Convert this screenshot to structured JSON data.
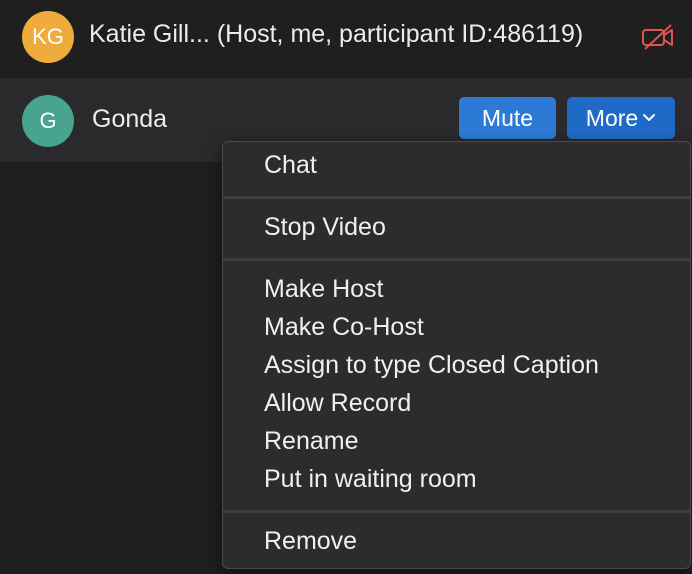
{
  "participants": {
    "host": {
      "initials": "KG",
      "name": "Katie Gill... (Host, me, participant ID:486119)",
      "avatar_color": "#efac3c",
      "video_icon": "video-off-icon"
    },
    "gonda": {
      "initials": "G",
      "name": "Gonda",
      "avatar_color": "#48a48e",
      "mute_label": "Mute",
      "more_label": "More"
    }
  },
  "menu": {
    "chat": "Chat",
    "stop_video": "Stop Video",
    "make_host": "Make Host",
    "make_cohost": "Make Co-Host",
    "assign_cc": "Assign to type Closed Caption",
    "allow_record": "Allow Record",
    "rename": "Rename",
    "waiting_room": "Put in waiting room",
    "remove": "Remove"
  },
  "colors": {
    "accent": "#2d7ad6",
    "video_off_red": "#e0544f"
  }
}
